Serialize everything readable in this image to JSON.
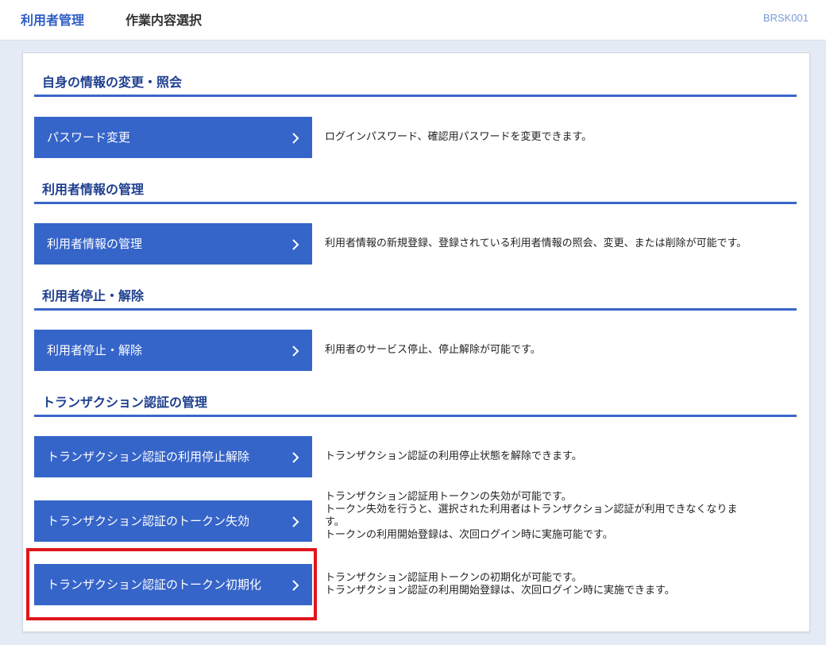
{
  "header": {
    "app_name": "利用者管理",
    "page_title": "作業内容選択",
    "screen_code": "BRSK001"
  },
  "sections": [
    {
      "heading": "自身の情報の変更・照会",
      "items": [
        {
          "button_label": "パスワード変更",
          "description": [
            "ログインパスワード、確認用パスワードを変更できます。"
          ]
        }
      ]
    },
    {
      "heading": "利用者情報の管理",
      "items": [
        {
          "button_label": "利用者情報の管理",
          "description": [
            "利用者情報の新規登録、登録されている利用者情報の照会、変更、または削除が可能です。"
          ]
        }
      ]
    },
    {
      "heading": "利用者停止・解除",
      "items": [
        {
          "button_label": "利用者停止・解除",
          "description": [
            "利用者のサービス停止、停止解除が可能です。"
          ]
        }
      ]
    },
    {
      "heading": "トランザクション認証の管理",
      "items": [
        {
          "button_label": "トランザクション認証の利用停止解除",
          "description": [
            "トランザクション認証の利用停止状態を解除できます。"
          ]
        },
        {
          "button_label": "トランザクション認証のトークン失効",
          "description": [
            "トランザクション認証用トークンの失効が可能です。",
            "トークン失効を行うと、選択された利用者はトランザクション認証が利用できなくなりま",
            "す。",
            "トークンの利用開始登録は、次回ログイン時に実施可能です。"
          ]
        },
        {
          "button_label": "トランザクション認証のトークン初期化",
          "description": [
            "トランザクション認証用トークンの初期化が可能です。",
            "トランザクション認証の利用開始登録は、次回ログイン時に実施できます。"
          ]
        }
      ]
    }
  ],
  "colors": {
    "accent": "#3665c9",
    "heading_text": "#1f3f8f",
    "highlight_box": "#e0161c",
    "page_background": "#e4ebf5"
  },
  "icons": {
    "button_arrow": "chevron-right-icon"
  }
}
